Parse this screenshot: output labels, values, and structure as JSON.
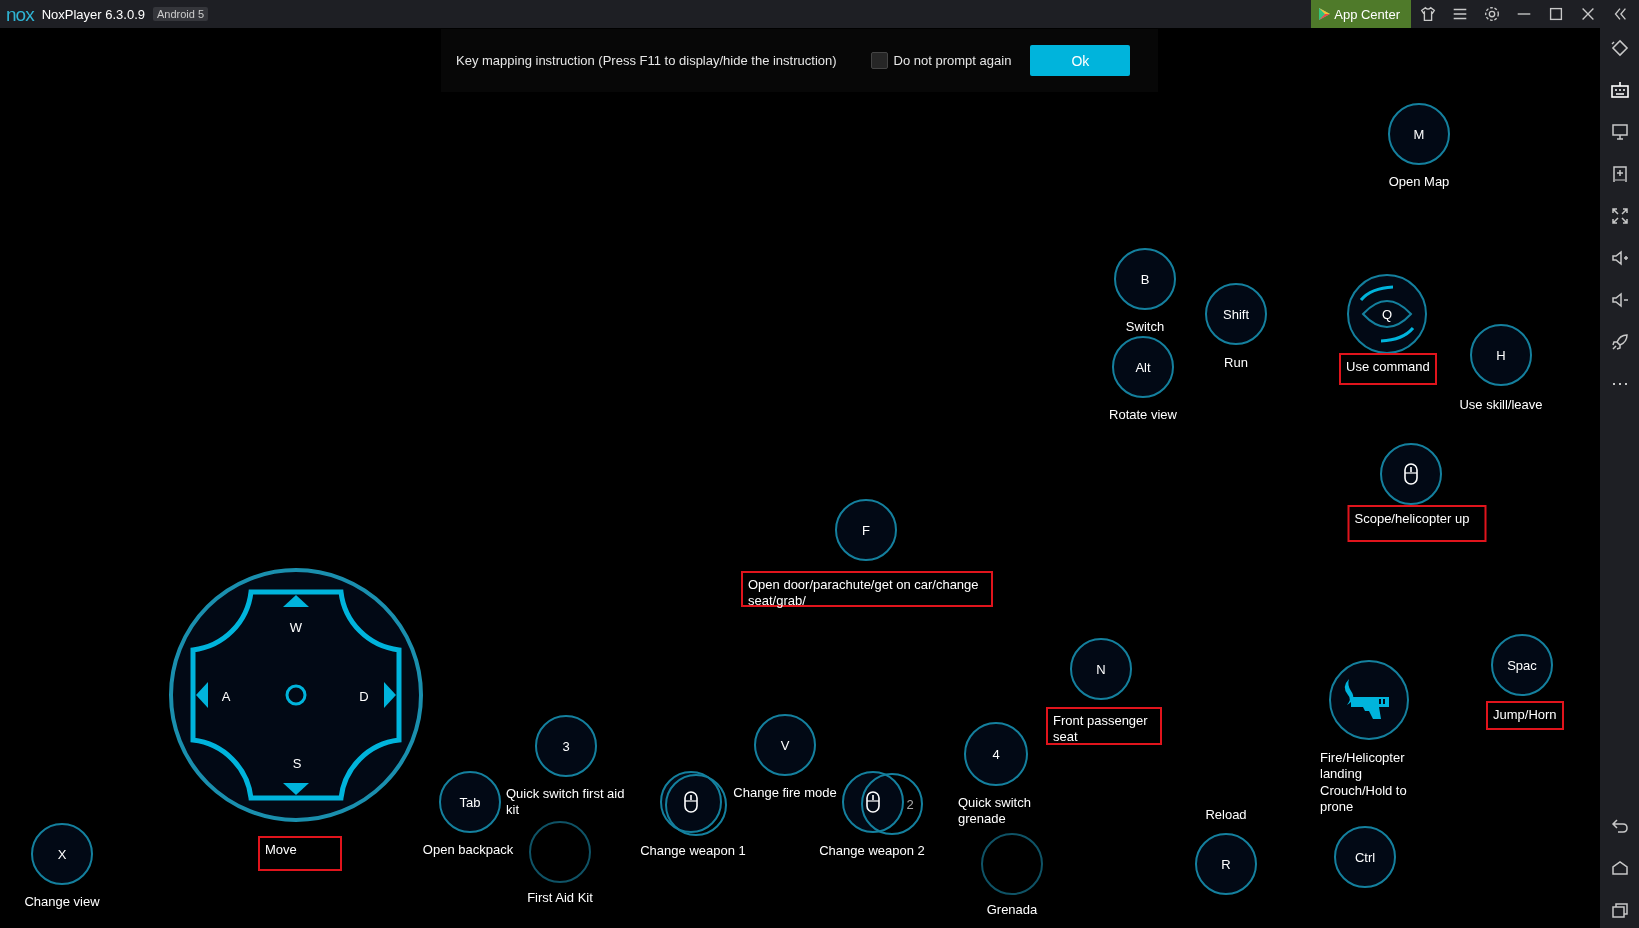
{
  "window": {
    "logo": "nox",
    "title": "NoxPlayer 6.3.0.9",
    "badge": "Android 5",
    "app_center": "App Center"
  },
  "instruction": {
    "text": "Key mapping instruction (Press F11 to display/hide the instruction)",
    "checkbox": {
      "label": "Do not prompt again",
      "checked": false
    },
    "button": "Ok"
  },
  "keys": [
    {
      "kind": "key",
      "key": "M",
      "label": "Open Map",
      "highlighted": false
    },
    {
      "kind": "key",
      "key": "B",
      "label": "Switch",
      "highlighted": false
    },
    {
      "kind": "key",
      "key": "Shift",
      "label": "Run",
      "highlighted": false
    },
    {
      "kind": "eye",
      "key": "Q",
      "label": "Use command",
      "highlighted": true
    },
    {
      "kind": "key",
      "key": "Alt",
      "label": "Rotate view",
      "highlighted": false
    },
    {
      "kind": "key",
      "key": "H",
      "label": "Use skill/leave",
      "highlighted": false
    },
    {
      "kind": "mouse",
      "label": "Scope/helicopter up",
      "highlighted": true
    },
    {
      "kind": "key",
      "key": "F",
      "label": "Open door/parachute/get on car/change seat/grab/",
      "highlighted": true
    },
    {
      "kind": "key",
      "key": "N",
      "label": "Front passenger seat",
      "highlighted": true
    },
    {
      "kind": "key",
      "key": "Spac",
      "label": "Jump/Horn",
      "highlighted": true
    },
    {
      "kind": "gun",
      "label": "Fire/Helicopter landing",
      "highlighted": false
    },
    {
      "kind": "dpad",
      "up": "W",
      "left": "A",
      "right": "D",
      "down": "S",
      "label": "Move",
      "highlighted": true
    },
    {
      "kind": "key",
      "key": "3",
      "label": "Quick switch first aid kit",
      "highlighted": false
    },
    {
      "kind": "key",
      "key": "V",
      "label": "Change fire mode",
      "highlighted": false
    },
    {
      "kind": "key",
      "key": "4",
      "label": "Quick switch grenade",
      "highlighted": false
    },
    {
      "kind": "key",
      "key": "Ctrl",
      "label": "Crouch/Hold to prone",
      "highlighted": false
    },
    {
      "kind": "key",
      "key": "R",
      "label": "Reload",
      "highlighted": false
    },
    {
      "kind": "key",
      "key": "Tab",
      "label": "Open backpack",
      "highlighted": false
    },
    {
      "kind": "key",
      "label": "First Aid Kit",
      "highlighted": false,
      "dim": true
    },
    {
      "kind": "mouse",
      "label": "Change weapon 1",
      "highlighted": false
    },
    {
      "kind": "mouse",
      "ghost_key": "2",
      "label": "Change weapon 2",
      "highlighted": false
    },
    {
      "kind": "key",
      "label": "Grenada",
      "highlighted": false,
      "dim": true
    },
    {
      "kind": "key",
      "key": "X",
      "label": "Change view",
      "highlighted": false
    }
  ]
}
